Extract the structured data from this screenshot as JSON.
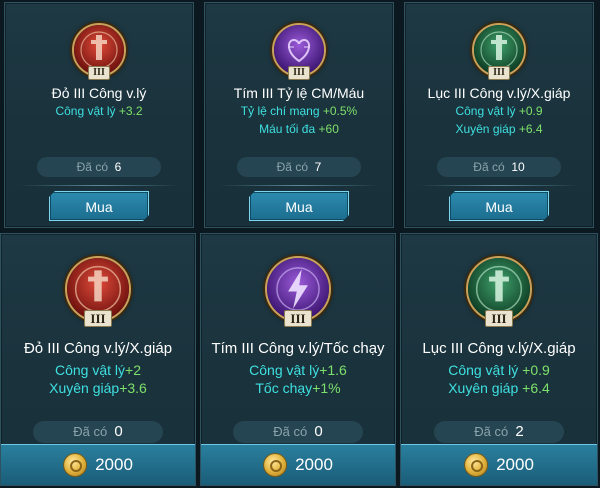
{
  "currency_icon": "gold-coin-icon",
  "colors": {
    "stat_name": "#3ee0e0",
    "stat_value": "#7ee06a",
    "red_emblem": "#a8201c",
    "purple_emblem": "#5b2a9c",
    "green_emblem": "#1d6b44"
  },
  "row1": [
    {
      "color": "red",
      "icon": "red-sword-emblem-icon",
      "level": "III",
      "title": "Đỏ III Công v.lý",
      "stats": [
        {
          "name": "Công vật lý",
          "value": " +3.2"
        }
      ],
      "owned_label": "Đã có",
      "owned_count": "6",
      "buy_label": "Mua"
    },
    {
      "color": "purple",
      "icon": "purple-heart-emblem-icon",
      "level": "III",
      "title": "Tím III Tỷ lệ CM/Máu",
      "stats": [
        {
          "name": "Tỷ lệ chí mạng",
          "value": " +0.5%"
        },
        {
          "name": "Máu tối đa",
          "value": " +60"
        }
      ],
      "owned_label": "Đã có",
      "owned_count": "7",
      "buy_label": "Mua"
    },
    {
      "color": "green",
      "icon": "green-sword-emblem-icon",
      "level": "III",
      "title": "Lục III Công v.lý/X.giáp",
      "stats": [
        {
          "name": "Công vật lý",
          "value": " +0.9"
        },
        {
          "name": "Xuyên giáp",
          "value": " +6.4"
        }
      ],
      "owned_label": "Đã có",
      "owned_count": "10",
      "buy_label": "Mua"
    }
  ],
  "row2": [
    {
      "color": "red",
      "icon": "red-sword-emblem-icon",
      "level": "III",
      "title": "Đỏ III Công v.lý/X.giáp",
      "stats": [
        {
          "name": "Công vật lý",
          "value": "+2"
        },
        {
          "name": "Xuyên giáp",
          "value": "+3.6"
        }
      ],
      "owned_label": "Đã có",
      "owned_count": "0",
      "price": "2000"
    },
    {
      "color": "purple",
      "icon": "purple-lightning-emblem-icon",
      "level": "III",
      "title": "Tím III Công v.lý/Tốc chạy",
      "stats": [
        {
          "name": "Công vật lý",
          "value": "+1.6"
        },
        {
          "name": "Tốc chạy",
          "value": "+1%"
        }
      ],
      "owned_label": "Đã có",
      "owned_count": "0",
      "price": "2000"
    },
    {
      "color": "green",
      "icon": "green-sword-emblem-icon",
      "level": "III",
      "title": "Lục III Công v.lý/X.giáp",
      "stats": [
        {
          "name": "Công vật lý",
          "value": " +0.9"
        },
        {
          "name": "Xuyên giáp",
          "value": " +6.4"
        }
      ],
      "owned_label": "Đã có",
      "owned_count": "2",
      "price": "2000"
    }
  ]
}
